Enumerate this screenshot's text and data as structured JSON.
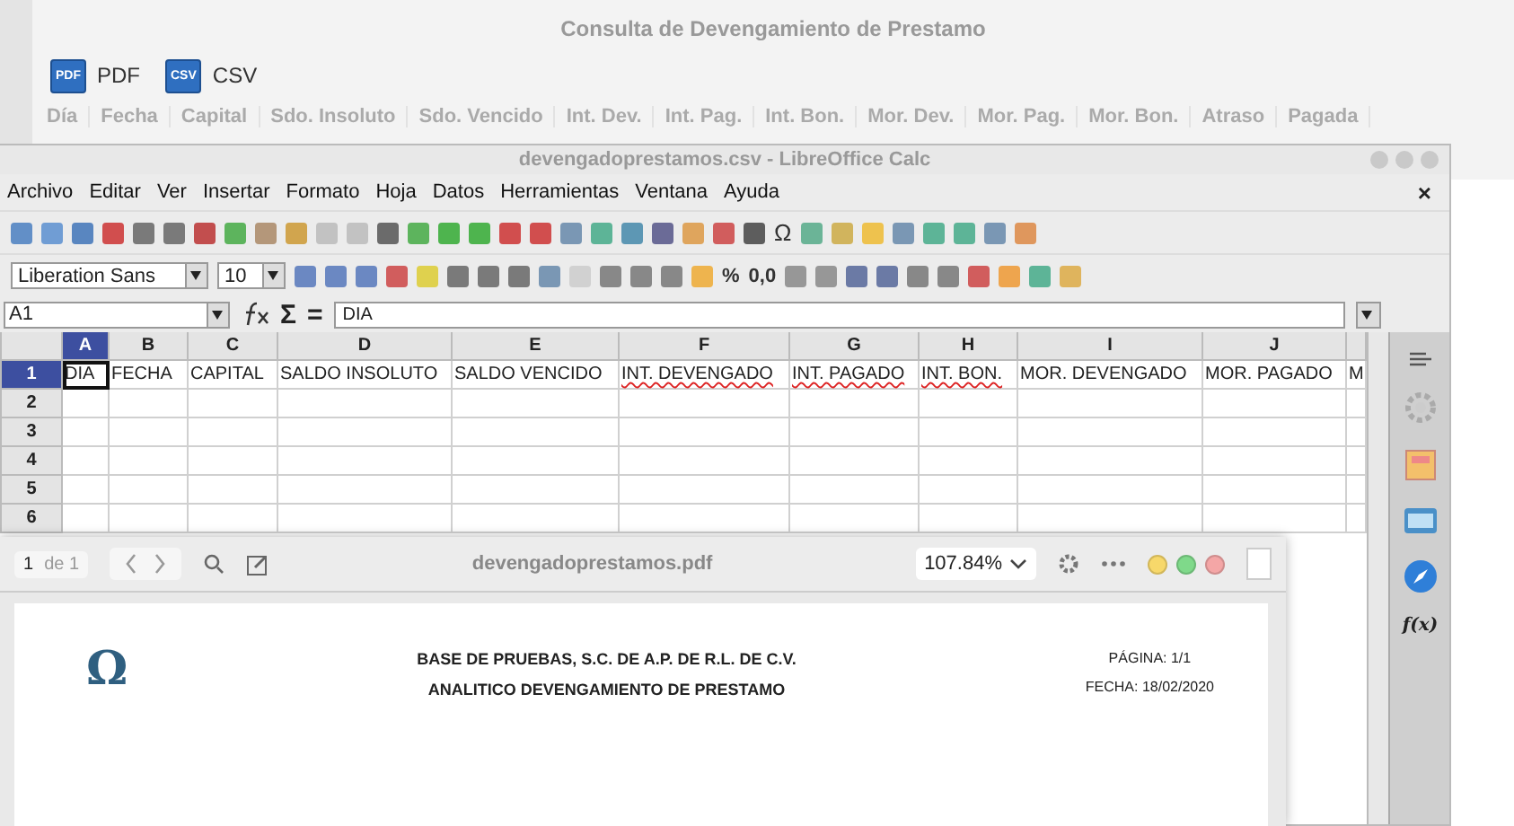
{
  "app_window": {
    "title": "Consulta de Devengamiento de Prestamo",
    "export_buttons": [
      {
        "icon_text": "PDF",
        "label": "PDF"
      },
      {
        "icon_text": "CSV",
        "label": "CSV"
      }
    ],
    "columns": [
      "Día",
      "Fecha",
      "Capital",
      "Sdo. Insoluto",
      "Sdo. Vencido",
      "Int. Dev.",
      "Int. Pag.",
      "Int. Bon.",
      "Mor. Dev.",
      "Mor. Pag.",
      "Mor. Bon.",
      "Atraso",
      "Pagada"
    ]
  },
  "calc_window": {
    "title": "devengadoprestamos.csv - LibreOffice Calc",
    "menu": [
      "Archivo",
      "Editar",
      "Ver",
      "Insertar",
      "Formato",
      "Hoja",
      "Datos",
      "Herramientas",
      "Ventana",
      "Ayuda"
    ],
    "close": "×",
    "special_character": "Ω",
    "font_name": "Liberation Sans",
    "font_size": "10",
    "number_formats": [
      "%",
      "0,0"
    ],
    "name_box": "A1",
    "formula_symbols": [
      "Σ",
      "="
    ],
    "formula": "DIA",
    "column_headers": [
      {
        "label": "A",
        "selected": true
      },
      {
        "label": "B",
        "selected": false
      },
      {
        "label": "C",
        "selected": false
      },
      {
        "label": "D",
        "selected": false
      },
      {
        "label": "E",
        "selected": false
      },
      {
        "label": "F",
        "selected": false
      },
      {
        "label": "G",
        "selected": false
      },
      {
        "label": "H",
        "selected": false
      },
      {
        "label": "I",
        "selected": false
      },
      {
        "label": "J",
        "selected": false
      }
    ],
    "rows": [
      {
        "number": "1",
        "selected": true,
        "cells": [
          {
            "text": "DIA",
            "selected": true,
            "misspelled": false
          },
          {
            "text": "FECHA",
            "selected": false,
            "misspelled": false
          },
          {
            "text": "CAPITAL",
            "selected": false,
            "misspelled": false
          },
          {
            "text": "SALDO INSOLUTO",
            "selected": false,
            "misspelled": false
          },
          {
            "text": "SALDO VENCIDO",
            "selected": false,
            "misspelled": false
          },
          {
            "text": "INT. DEVENGADO",
            "selected": false,
            "misspelled": true
          },
          {
            "text": "INT. PAGADO",
            "selected": false,
            "misspelled": true
          },
          {
            "text": "INT. BON.",
            "selected": false,
            "misspelled": true
          },
          {
            "text": "MOR. DEVENGADO",
            "selected": false,
            "misspelled": false
          },
          {
            "text": "MOR. PAGADO",
            "selected": false,
            "misspelled": false
          },
          {
            "text": "M",
            "selected": false,
            "misspelled": false
          }
        ]
      },
      {
        "number": "2",
        "selected": false,
        "cells": []
      },
      {
        "number": "3",
        "selected": false,
        "cells": []
      },
      {
        "number": "4",
        "selected": false,
        "cells": []
      },
      {
        "number": "5",
        "selected": false,
        "cells": []
      },
      {
        "number": "6",
        "selected": false,
        "cells": []
      }
    ],
    "sidebar_function_label": "f(x)"
  },
  "pdf_window": {
    "page_field": "1",
    "page_count": "de 1",
    "title": "devengadoprestamos.pdf",
    "zoom": "107.84%",
    "window_buttons": [
      {
        "color": "#f7d86a"
      },
      {
        "color": "#7fd98a"
      },
      {
        "color": "#f4a6a6"
      }
    ],
    "logo": "Ω",
    "heading": [
      "BASE DE PRUEBAS, S.C. DE A.P. DE R.L. DE C.V.",
      "ANALITICO DEVENGAMIENTO DE PRESTAMO"
    ],
    "meta": [
      "PÁGINA: 1/1",
      "FECHA: 18/02/2020"
    ]
  }
}
